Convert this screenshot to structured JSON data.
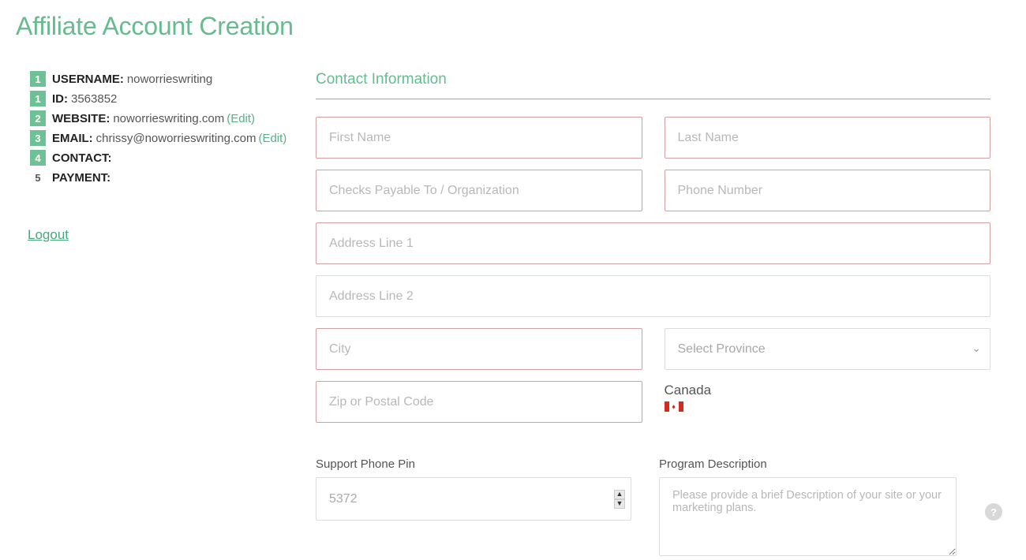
{
  "page_title": "Affiliate Account Creation",
  "sidebar": {
    "steps": [
      {
        "num": "1",
        "label": "USERNAME:",
        "value": "noworrieswriting",
        "edit": "",
        "completed": true
      },
      {
        "num": "1",
        "label": "ID:",
        "value": "3563852",
        "edit": "",
        "completed": true
      },
      {
        "num": "2",
        "label": "WEBSITE:",
        "value": "noworrieswriting.com",
        "edit": "(Edit)",
        "completed": true
      },
      {
        "num": "3",
        "label": "EMAIL:",
        "value": "chrissy@noworrieswriting.com",
        "edit": "(Edit)",
        "completed": true
      },
      {
        "num": "4",
        "label": "CONTACT:",
        "value": "",
        "edit": "",
        "completed": true
      },
      {
        "num": "5",
        "label": "PAYMENT:",
        "value": "",
        "edit": "",
        "completed": false
      }
    ],
    "logout": "Logout"
  },
  "main": {
    "section_title": "Contact Information",
    "placeholders": {
      "first_name": "First Name",
      "last_name": "Last Name",
      "checks": "Checks Payable To / Organization",
      "phone": "Phone Number",
      "addr1": "Address Line 1",
      "addr2": "Address Line 2",
      "city": "City",
      "province": "Select Province",
      "zip": "Zip or Postal Code",
      "desc": "Please provide a brief Description of your site or your marketing plans."
    },
    "country": "Canada",
    "support_pin_label": "Support Phone Pin",
    "support_pin_value": "5372",
    "program_desc_label": "Program Description"
  },
  "help_tooltip": "?"
}
